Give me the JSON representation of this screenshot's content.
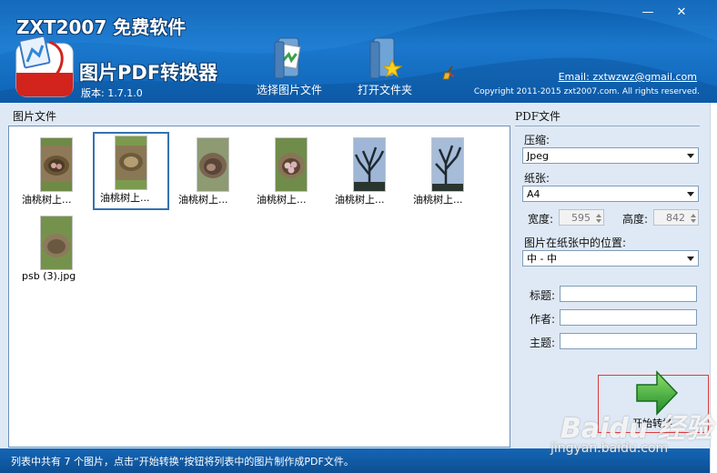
{
  "header": {
    "brand": "ZXT2007 免费软件",
    "product_title": "图片PDF转换器",
    "version": "版本: 1.7.1.0",
    "email": "Email: zxtwzwz@gmail.com",
    "copyright": "Copyright 2011-2015 zxt2007.com. All rights reserved.",
    "minimize_glyph": "—",
    "close_glyph": "✕"
  },
  "toolbar": {
    "select_images": "选择图片文件",
    "open_folder": "打开文件夹",
    "clean_icon": "broom-icon"
  },
  "images_panel": {
    "title": "图片文件",
    "items": [
      {
        "caption": "油桃树上...",
        "selected": false
      },
      {
        "caption": "油桃树上...",
        "selected": true
      },
      {
        "caption": "油桃树上...",
        "selected": false
      },
      {
        "caption": "油桃树上...",
        "selected": false
      },
      {
        "caption": "油桃树上...",
        "selected": false
      },
      {
        "caption": "油桃树上...",
        "selected": false
      },
      {
        "caption": "psb (3).jpg",
        "selected": false
      }
    ]
  },
  "pdf_panel": {
    "title": "PDF文件",
    "compression_label": "压缩:",
    "compression_value": "Jpeg",
    "paper_label": "纸张:",
    "paper_value": "A4",
    "width_label": "宽度:",
    "width_value": "595",
    "height_label": "高度:",
    "height_value": "842",
    "position_label": "图片在纸张中的位置:",
    "position_value": "中 - 中",
    "title_label": "标题:",
    "author_label": "作者:",
    "subject_label": "主题:",
    "title_value": "",
    "author_value": "",
    "subject_value": "",
    "start_label": "开始转换"
  },
  "status": {
    "text": "列表中共有 7 个图片，点击“开始转换”按钮将列表中的图片制作成PDF文件。"
  },
  "watermark": {
    "brand": "Baidu 经验",
    "url": "jingyan.baidu.com"
  }
}
